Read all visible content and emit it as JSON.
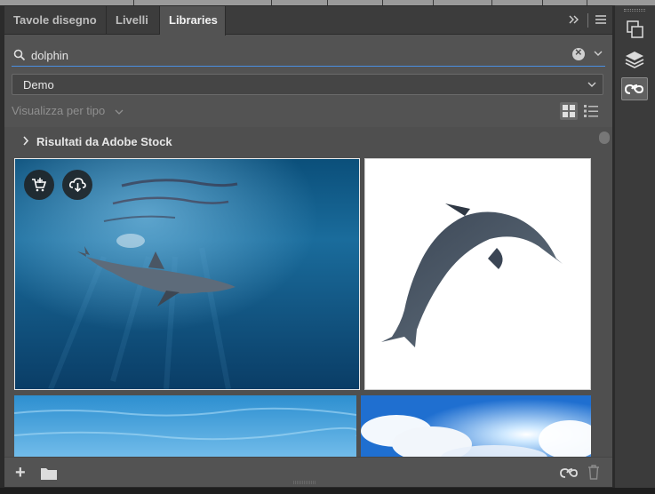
{
  "tabs": [
    {
      "label": "Tavole disegno",
      "active": false
    },
    {
      "label": "Livelli",
      "active": false
    },
    {
      "label": "Libraries",
      "active": true
    }
  ],
  "tab_controls": {
    "collapse_icon": "double-chevron-right-icon",
    "menu_icon": "hamburger-menu-icon"
  },
  "search": {
    "value": "dolphin",
    "icon": "search-icon",
    "clear_icon": "clear-icon"
  },
  "library_select": {
    "selected": "Demo"
  },
  "view": {
    "label": "Visualizza per tipo",
    "grid_icon": "grid-view-icon",
    "list_icon": "list-view-icon"
  },
  "results": {
    "section_title": "Risultati da Adobe Stock",
    "items": [
      {
        "subject": "dolphin-underwater",
        "actions": [
          "license-cart-icon",
          "save-to-library-icon"
        ]
      },
      {
        "subject": "dolphin-jumping-white"
      },
      {
        "subject": "water-surface"
      },
      {
        "subject": "sky-sun-clouds"
      }
    ]
  },
  "footer": {
    "add_icon": "plus-icon",
    "folder_icon": "folder-icon",
    "cc_icon": "creative-cloud-icon",
    "trash_icon": "trash-icon"
  },
  "right_toolbar": [
    {
      "icon": "artboards-icon",
      "active": false
    },
    {
      "icon": "layers-icon",
      "active": false
    },
    {
      "icon": "libraries-icon",
      "active": true
    }
  ],
  "colors": {
    "accent": "#4a8fe2",
    "panel": "#535353",
    "tabbar": "#3c3c3c"
  }
}
